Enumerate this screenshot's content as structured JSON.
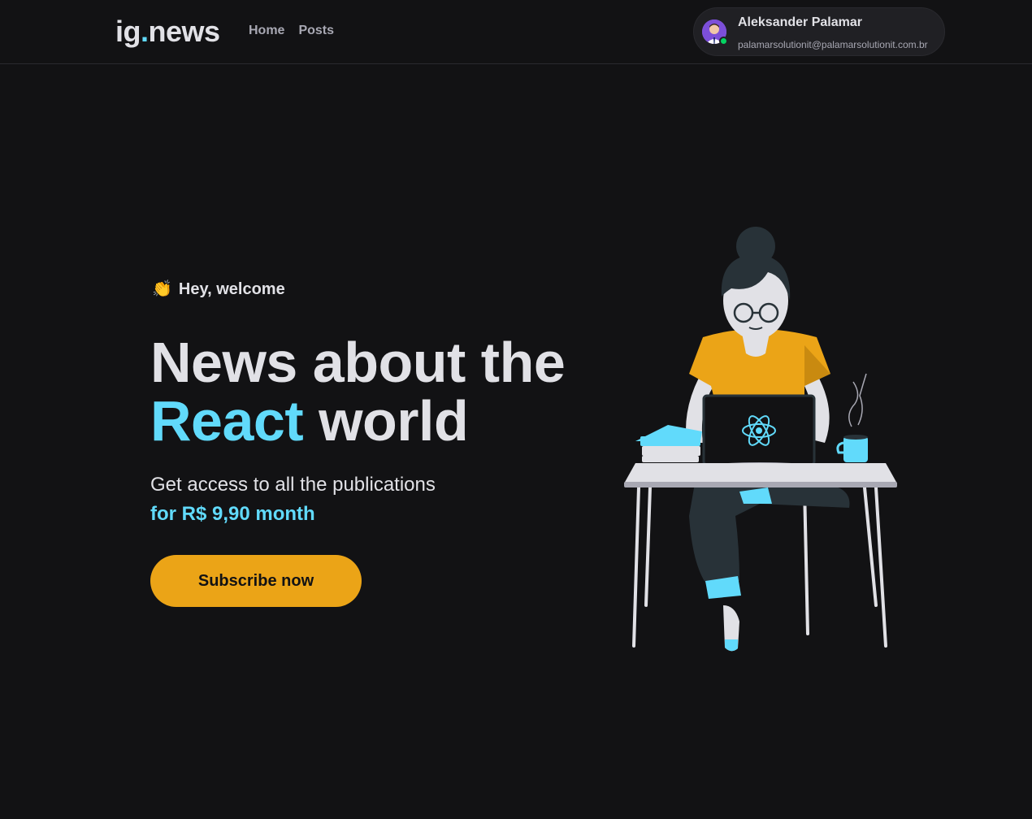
{
  "header": {
    "logo_prefix": "ig",
    "logo_dot": ".",
    "logo_suffix": "news",
    "nav": [
      {
        "label": "Home"
      },
      {
        "label": "Posts"
      }
    ],
    "user": {
      "name": "Aleksander Palamar",
      "email": "palamarsolutionit@palamarsolutionit.com.br",
      "avatar_icon": "user-avatar",
      "status_color": "#04d361"
    }
  },
  "hero": {
    "greeting_icon": "👏",
    "greeting_text": "Hey, welcome",
    "headline_line1": "News about the",
    "headline_accent": "React",
    "headline_rest": " world",
    "subtitle": "Get access to all the publications",
    "price": "for R$ 9,90 month",
    "cta_label": "Subscribe now"
  },
  "illustration": {
    "description_icon": "woman-at-laptop-illustration",
    "laptop_logo_icon": "react-logo-icon"
  },
  "colors": {
    "background": "#121214",
    "accent_cyan": "#61dafb",
    "accent_yellow": "#eba417",
    "text_primary": "#e1e1e6",
    "text_secondary": "#a8a8b3"
  }
}
